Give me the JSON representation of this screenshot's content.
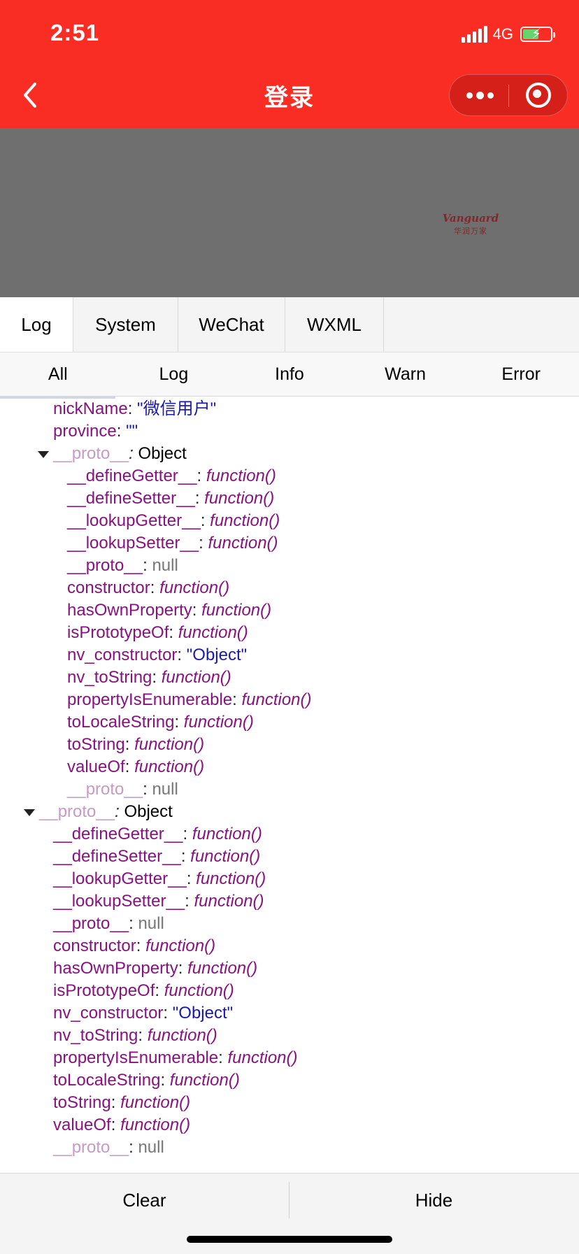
{
  "status_bar": {
    "time": "2:51",
    "network": "4G"
  },
  "nav": {
    "title": "登录"
  },
  "brand": {
    "name": "Vanguard",
    "subtitle": "华润万家"
  },
  "tabs": [
    {
      "label": "Log",
      "active": true
    },
    {
      "label": "System",
      "active": false
    },
    {
      "label": "WeChat",
      "active": false
    },
    {
      "label": "WXML",
      "active": false
    }
  ],
  "filters": [
    "All",
    "Log",
    "Info",
    "Warn",
    "Error"
  ],
  "log_rows": [
    {
      "indent": 1,
      "key": "nickName",
      "value": "\"微信用户\"",
      "type": "string"
    },
    {
      "indent": 1,
      "key": "province",
      "value": "\"\"",
      "type": "string"
    },
    {
      "indent": 1,
      "key": "__proto__",
      "value": "Object",
      "type": "object",
      "expanded": true
    },
    {
      "indent": 2,
      "key": "__defineGetter__",
      "value": "function()",
      "type": "function"
    },
    {
      "indent": 2,
      "key": "__defineSetter__",
      "value": "function()",
      "type": "function"
    },
    {
      "indent": 2,
      "key": "__lookupGetter__",
      "value": "function()",
      "type": "function"
    },
    {
      "indent": 2,
      "key": "__lookupSetter__",
      "value": "function()",
      "type": "function"
    },
    {
      "indent": 2,
      "key": "__proto__",
      "value": "null",
      "type": "null"
    },
    {
      "indent": 2,
      "key": "constructor",
      "value": "function()",
      "type": "function"
    },
    {
      "indent": 2,
      "key": "hasOwnProperty",
      "value": "function()",
      "type": "function"
    },
    {
      "indent": 2,
      "key": "isPrototypeOf",
      "value": "function()",
      "type": "function"
    },
    {
      "indent": 2,
      "key": "nv_constructor",
      "value": "\"Object\"",
      "type": "string"
    },
    {
      "indent": 2,
      "key": "nv_toString",
      "value": "function()",
      "type": "function"
    },
    {
      "indent": 2,
      "key": "propertyIsEnumerable",
      "value": "function()",
      "type": "function"
    },
    {
      "indent": 2,
      "key": "toLocaleString",
      "value": "function()",
      "type": "function"
    },
    {
      "indent": 2,
      "key": "toString",
      "value": "function()",
      "type": "function"
    },
    {
      "indent": 2,
      "key": "valueOf",
      "value": "function()",
      "type": "function"
    },
    {
      "indent": 2,
      "key": "__proto__",
      "value": "null",
      "type": "null",
      "dim": true
    },
    {
      "indent": 0,
      "key": "__proto__",
      "value": "Object",
      "type": "object",
      "expanded": true
    },
    {
      "indent": 1,
      "key": "__defineGetter__",
      "value": "function()",
      "type": "function"
    },
    {
      "indent": 1,
      "key": "__defineSetter__",
      "value": "function()",
      "type": "function"
    },
    {
      "indent": 1,
      "key": "__lookupGetter__",
      "value": "function()",
      "type": "function"
    },
    {
      "indent": 1,
      "key": "__lookupSetter__",
      "value": "function()",
      "type": "function"
    },
    {
      "indent": 1,
      "key": "__proto__",
      "value": "null",
      "type": "null"
    },
    {
      "indent": 1,
      "key": "constructor",
      "value": "function()",
      "type": "function"
    },
    {
      "indent": 1,
      "key": "hasOwnProperty",
      "value": "function()",
      "type": "function"
    },
    {
      "indent": 1,
      "key": "isPrototypeOf",
      "value": "function()",
      "type": "function"
    },
    {
      "indent": 1,
      "key": "nv_constructor",
      "value": "\"Object\"",
      "type": "string"
    },
    {
      "indent": 1,
      "key": "nv_toString",
      "value": "function()",
      "type": "function"
    },
    {
      "indent": 1,
      "key": "propertyIsEnumerable",
      "value": "function()",
      "type": "function"
    },
    {
      "indent": 1,
      "key": "toLocaleString",
      "value": "function()",
      "type": "function"
    },
    {
      "indent": 1,
      "key": "toString",
      "value": "function()",
      "type": "function"
    },
    {
      "indent": 1,
      "key": "valueOf",
      "value": "function()",
      "type": "function"
    },
    {
      "indent": 1,
      "key": "__proto__",
      "value": "null",
      "type": "null",
      "dim": true
    }
  ],
  "bottom_bar": {
    "clear_label": "Clear",
    "hide_label": "Hide"
  }
}
